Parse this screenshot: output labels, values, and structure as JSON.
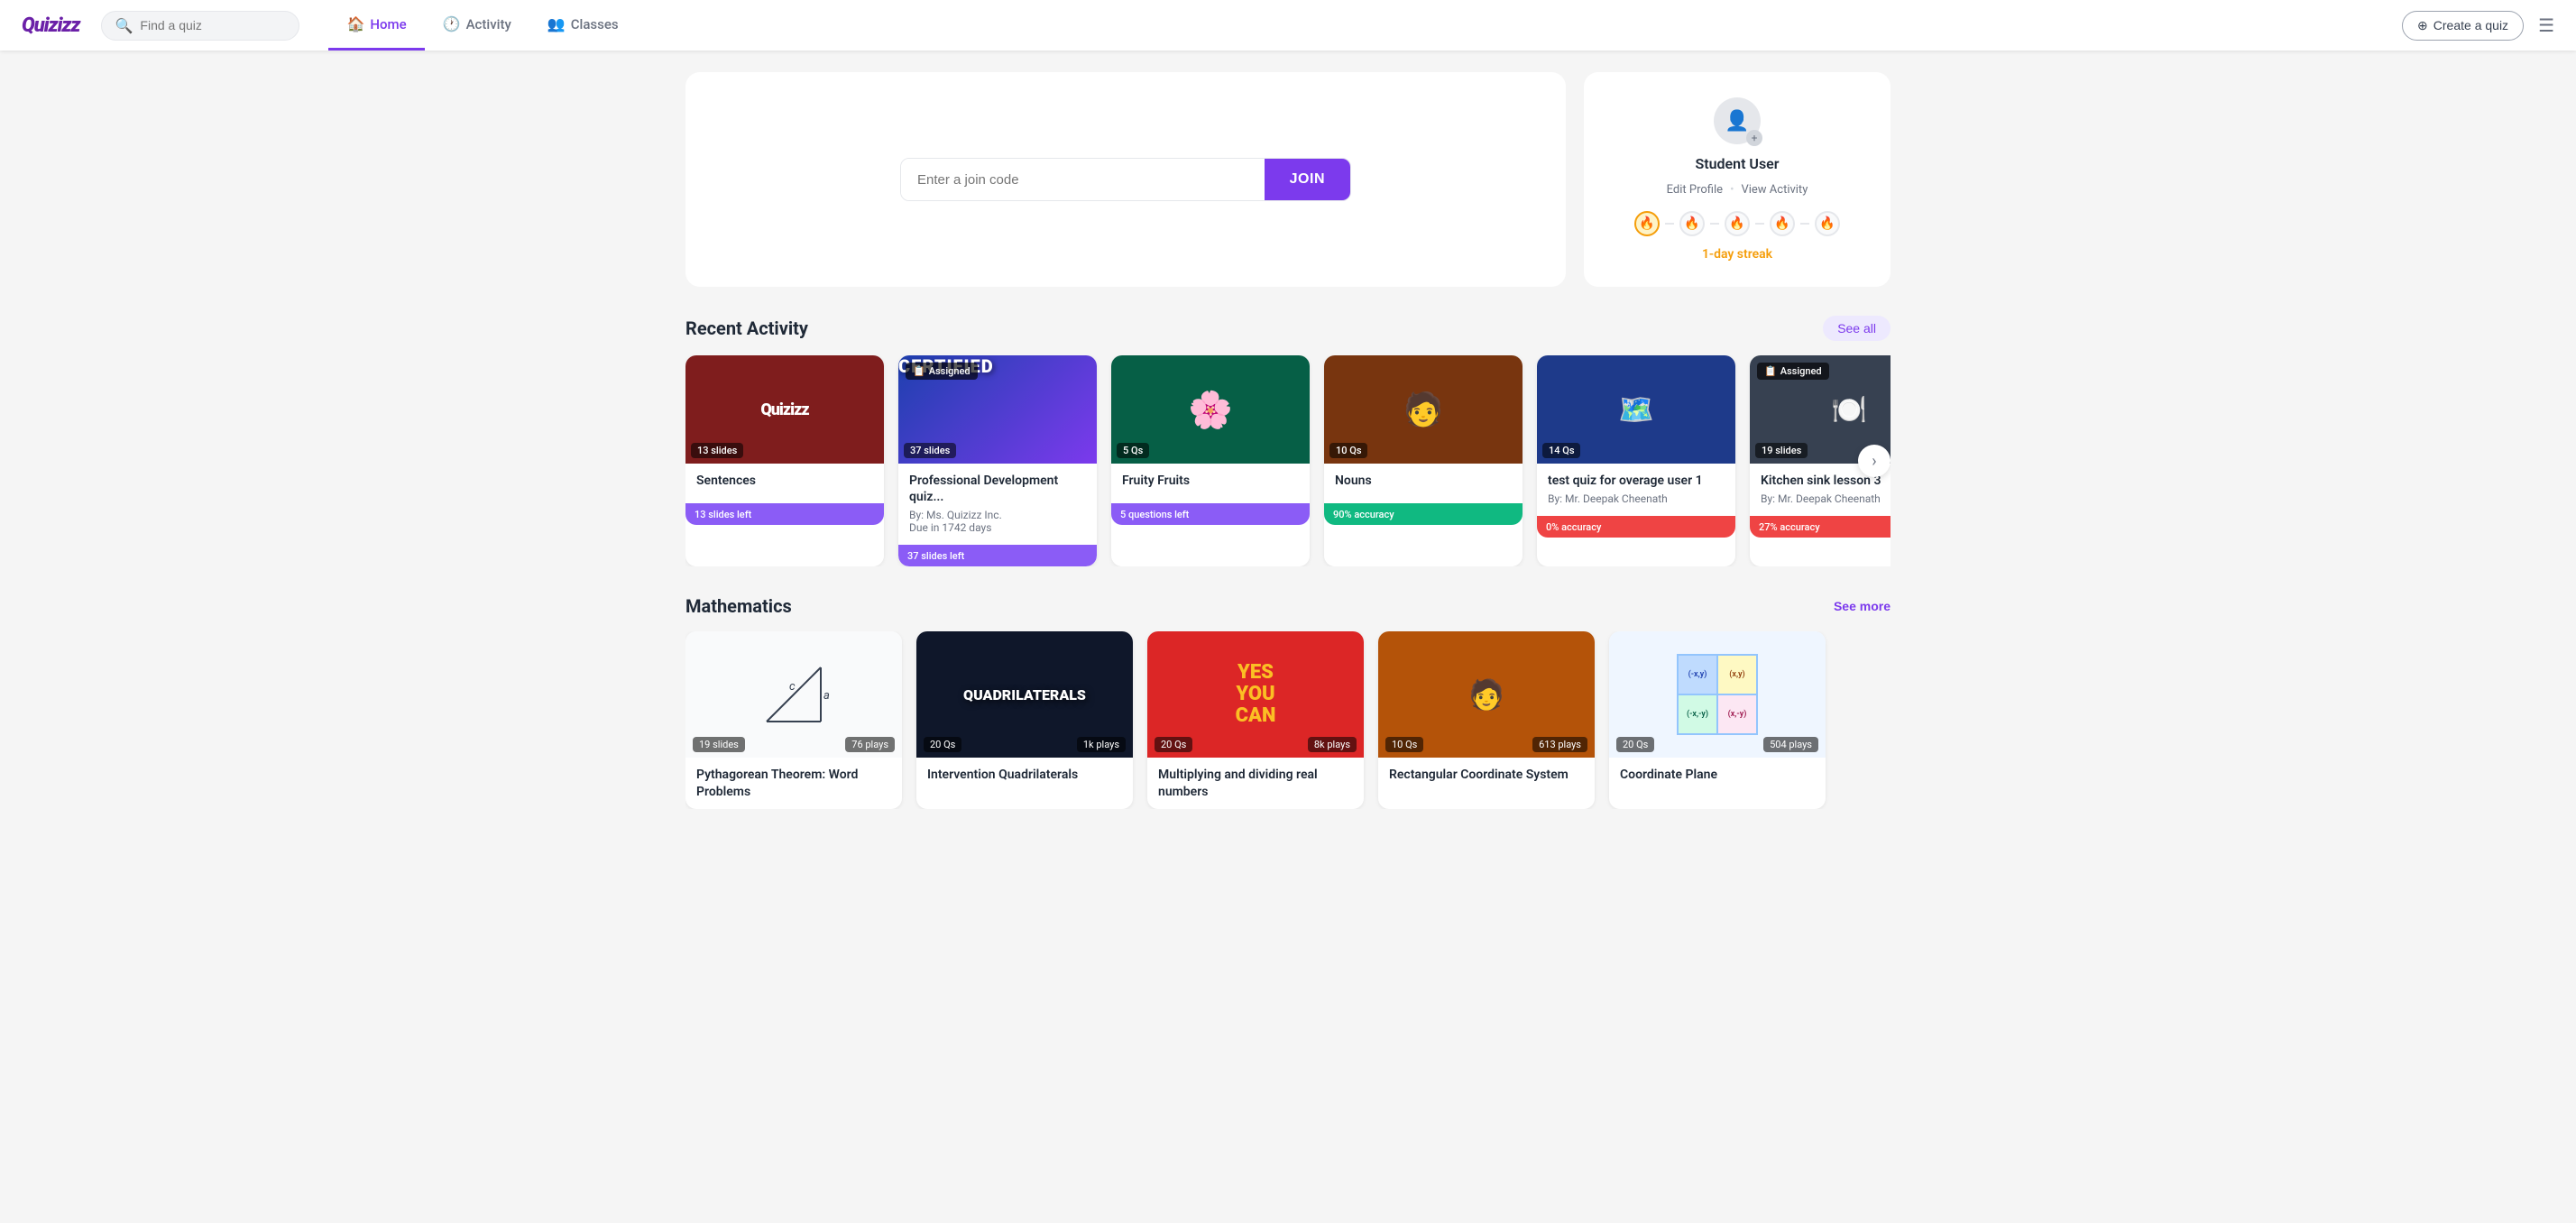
{
  "brand": {
    "logo": "Quizizz"
  },
  "navbar": {
    "search_placeholder": "Find a quiz",
    "nav_items": [
      {
        "id": "home",
        "label": "Home",
        "icon": "🏠",
        "active": true
      },
      {
        "id": "activity",
        "label": "Activity",
        "icon": "🕐",
        "active": false
      },
      {
        "id": "classes",
        "label": "Classes",
        "icon": "👥",
        "active": false
      }
    ],
    "create_label": "Create a quiz",
    "menu_icon": "☰"
  },
  "join": {
    "placeholder": "Enter a join code",
    "button_label": "JOIN"
  },
  "profile": {
    "name": "Student User",
    "edit_label": "Edit Profile",
    "view_label": "View Activity",
    "separator": "•",
    "streak_label": "1-day streak",
    "streak_dots": [
      {
        "active": true
      },
      {
        "active": false
      },
      {
        "active": false
      },
      {
        "active": false
      },
      {
        "active": false
      }
    ]
  },
  "recent_activity": {
    "title": "Recent Activity",
    "see_all_label": "See all",
    "cards": [
      {
        "id": "sentences",
        "title": "Sentences",
        "badge": "13 slides",
        "progress_label": "13 slides left",
        "progress_color": "purple",
        "thumb_type": "sentences"
      },
      {
        "id": "professional",
        "title": "Professional Development quiz...",
        "badge": "37 slides",
        "assigned": true,
        "assigned_label": "Assigned",
        "meta_by": "By: Ms. Quizizz Inc.",
        "meta_due": "Due in 1742 days",
        "progress_label": "37 slides left",
        "progress_color": "purple",
        "thumb_type": "certified"
      },
      {
        "id": "fruity",
        "title": "Fruity Fruits",
        "badge": "5 Qs",
        "progress_label": "5 questions left",
        "progress_color": "purple",
        "thumb_type": "fruits"
      },
      {
        "id": "nouns",
        "title": "Nouns",
        "badge": "10 Qs",
        "progress_label": "90% accuracy",
        "progress_color": "green",
        "thumb_type": "nouns"
      },
      {
        "id": "test-quiz",
        "title": "test quiz for overage user 1",
        "badge": "14 Qs",
        "progress_label": "0% accuracy",
        "progress_color": "red",
        "meta_by": "By: Mr. Deepak Cheenath",
        "thumb_type": "test"
      },
      {
        "id": "kitchen",
        "title": "Kitchen sink lesson 3",
        "badge": "19 slides",
        "assigned": true,
        "assigned_label": "Assigned",
        "meta_by": "By: Mr. Deepak Cheenath",
        "progress_label": "27% accuracy",
        "progress_color": "red",
        "thumb_type": "kitchen"
      }
    ]
  },
  "mathematics": {
    "title": "Mathematics",
    "see_more_label": "See more",
    "cards": [
      {
        "id": "pythagorean",
        "title": "Pythagorean Theorem: Word Problems",
        "badge_left": "19 slides",
        "badge_right": "76 plays",
        "thumb_type": "pythagorean"
      },
      {
        "id": "quadrilaterals",
        "title": "Intervention Quadrilaterals",
        "badge_left": "20 Qs",
        "badge_right": "1k plays",
        "thumb_type": "quadrilaterals"
      },
      {
        "id": "multiplying",
        "title": "Multiplying and dividing real numbers",
        "badge_left": "20 Qs",
        "badge_right": "8k plays",
        "thumb_type": "multiplying"
      },
      {
        "id": "rectangular",
        "title": "Rectangular Coordinate System",
        "badge_left": "10 Qs",
        "badge_right": "613 plays",
        "thumb_type": "rectangular"
      },
      {
        "id": "coordinate",
        "title": "Coordinate Plane",
        "badge_left": "20 Qs",
        "badge_right": "504 plays",
        "thumb_type": "coordinate"
      }
    ]
  }
}
